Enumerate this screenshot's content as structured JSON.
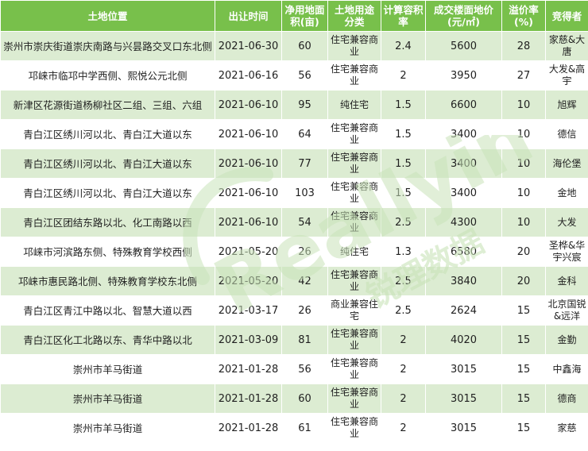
{
  "table": {
    "headers": [
      "土地位置",
      "出让时间",
      "净用地面积(亩)",
      "土地用途分类",
      "计算容积率",
      "成交楼面地价(元/㎡)",
      "溢价率(%)",
      "竞得者"
    ],
    "rows": [
      [
        "崇州市崇庆街道崇庆南路与兴昙路交叉口东北侧",
        "2021-06-30",
        "60",
        "住宅兼容商业",
        "2.4",
        "5600",
        "28",
        "家慈&大唐"
      ],
      [
        "邛崃市临邛中学西侧、熙悦公元北侧",
        "2021-06-16",
        "56",
        "住宅兼容商业",
        "2",
        "3950",
        "27",
        "大发&高宇"
      ],
      [
        "新津区花源街道杨柳社区二组、三组、六组",
        "2021-06-10",
        "95",
        "纯住宅",
        "1.5",
        "6600",
        "10",
        "旭辉"
      ],
      [
        "青白江区绣川河以北、青白江大道以东",
        "2021-06-10",
        "64",
        "住宅兼容商业",
        "1.5",
        "3400",
        "10",
        "德信"
      ],
      [
        "青白江区绣川河以北、青白江大道以东",
        "2021-06-10",
        "77",
        "住宅兼容商业",
        "1.5",
        "3400",
        "10",
        "海伦堡"
      ],
      [
        "青白江区绣川河以北、青白江大道以东",
        "2021-06-10",
        "103",
        "住宅兼容商业",
        "1.5",
        "3400",
        "10",
        "金地"
      ],
      [
        "青白江区团结东路以北、化工南路以西",
        "2021-06-10",
        "54",
        "住宅兼容商业",
        "2.5",
        "4300",
        "10",
        "大发"
      ],
      [
        "邛崃市河滨路东侧、特殊教育学校西侧",
        "2021-05-20",
        "26",
        "纯住宅",
        "1.3",
        "6580",
        "20",
        "圣桦&华宇兴宸"
      ],
      [
        "邛崃市惠民路北侧、特殊教育学校东北侧",
        "2021-05-20",
        "42",
        "住宅兼容商业",
        "2.5",
        "3840",
        "20",
        "金科"
      ],
      [
        "青白江区青江中路以北、智慧大道以西",
        "2021-03-17",
        "26",
        "商业兼容住宅",
        "2.5",
        "2624",
        "15",
        "北京国锐&远洋"
      ],
      [
        "青白江区化工北路以东、青华中路以北",
        "2021-03-09",
        "81",
        "住宅兼容商业",
        "2",
        "4020",
        "15",
        "金勤"
      ],
      [
        "崇州市羊马街道",
        "2021-01-28",
        "56",
        "住宅兼容商业",
        "2",
        "3015",
        "15",
        "中鑫海"
      ],
      [
        "崇州市羊马街道",
        "2021-01-28",
        "60",
        "住宅兼容商业",
        "2",
        "3015",
        "15",
        "德商"
      ],
      [
        "崇州市羊马街道",
        "2021-01-28",
        "61",
        "住宅兼容商业",
        "2",
        "3015",
        "15",
        "家慈"
      ]
    ]
  },
  "watermark": {
    "text_latin": "Reallyinfo",
    "text_cn": "锐理数据",
    "color": "#c9e3b9"
  }
}
